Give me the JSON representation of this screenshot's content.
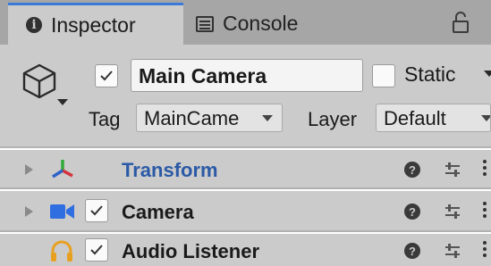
{
  "tabs": [
    {
      "label": "Inspector",
      "icon": "info-icon",
      "active": true
    },
    {
      "label": "Console",
      "icon": "console-icon",
      "active": false
    }
  ],
  "tab_accent": "#3a79d8",
  "lock_icon": "lock-icon",
  "object": {
    "icon": "cube-icon",
    "active": true,
    "name": "Main Camera",
    "static_label": "Static",
    "static_checked": false,
    "tag_label": "Tag",
    "tag_value": "MainCame",
    "layer_label": "Layer",
    "layer_value": "Default"
  },
  "components": [
    {
      "name": "Transform",
      "icon": "transform-icon",
      "has_checkbox": false,
      "name_color": "#2b5aa6"
    },
    {
      "name": "Camera",
      "icon": "camera-icon",
      "has_checkbox": true,
      "checked": true
    },
    {
      "name": "Audio Listener",
      "icon": "headphones-icon",
      "has_checkbox": true,
      "checked": true
    }
  ],
  "component_actions": {
    "help": "?",
    "help_icon": "help-icon",
    "preset_icon": "preset-icon",
    "menu_icon": "kebab-menu-icon"
  }
}
